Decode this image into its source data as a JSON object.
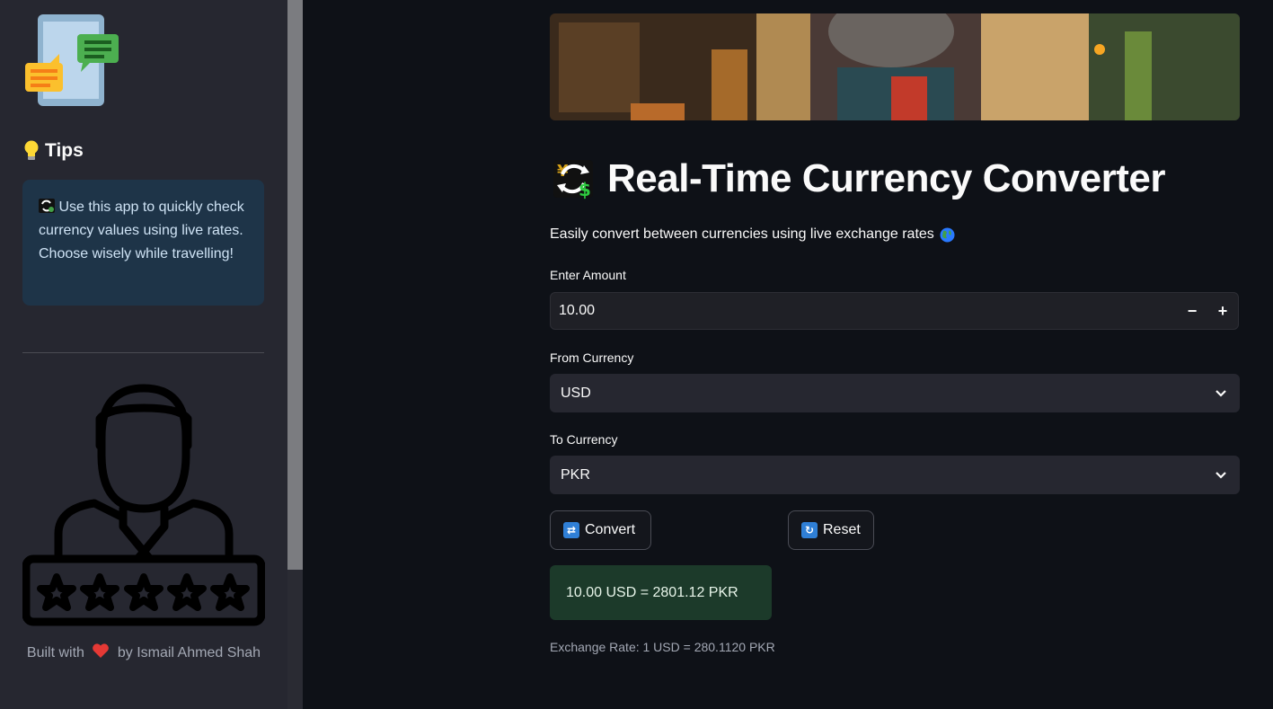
{
  "sidebar": {
    "tips_heading": "Tips",
    "tips_text": "Use this app to quickly check currency values using live rates. Choose wisely while travelling!",
    "footer_prefix": "Built with",
    "footer_suffix": "by Ismail Ahmed Shah",
    "stars_count": 5
  },
  "main": {
    "title": "Real-Time Currency Converter",
    "subtitle": "Easily convert between currencies using live exchange rates",
    "amount": {
      "label": "Enter Amount",
      "value": "10.00",
      "minus": "−",
      "plus": "+"
    },
    "from": {
      "label": "From Currency",
      "value": "USD"
    },
    "to": {
      "label": "To Currency",
      "value": "PKR"
    },
    "convert_button": "Convert",
    "reset_button": "Reset",
    "result": "10.00 USD = 2801.12 PKR",
    "exchange_rate": "Exchange Rate: 1 USD = 280.1120 PKR"
  },
  "colors": {
    "background": "#0e1117",
    "sidebar": "#262730",
    "info_box": "#1e3448",
    "success_box": "#1c3a2a"
  },
  "icons": [
    "chat-phone-icon",
    "lightbulb-icon",
    "exchange-emoji-icon",
    "person-rating-icon",
    "heart-icon",
    "currency-exchange-icon",
    "globe-icon",
    "chevron-down-icon",
    "repeat-icon",
    "refresh-icon"
  ]
}
